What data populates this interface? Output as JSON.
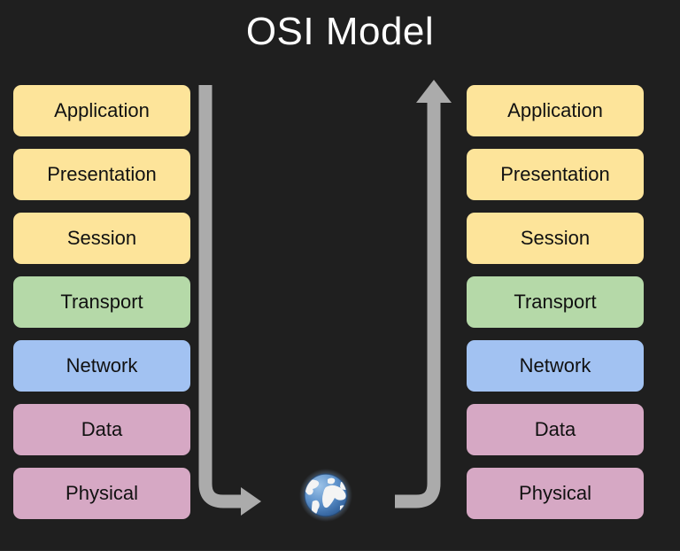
{
  "diagram": {
    "title": "OSI Model",
    "background_color": "#1f1f1f",
    "title_color": "#ffffff"
  },
  "layer_colors": {
    "application": "#fde49a",
    "presentation": "#fde49a",
    "session": "#fde49a",
    "transport": "#b5d9a8",
    "network": "#a2c2f2",
    "data": "#d6a8c4",
    "physical": "#d6a8c4",
    "text": "#111111"
  },
  "left_stack": {
    "name": "left-host-layers",
    "layers": [
      {
        "label": "Application",
        "color": "#fde49a"
      },
      {
        "label": "Presentation",
        "color": "#fde49a"
      },
      {
        "label": "Session",
        "color": "#fde49a"
      },
      {
        "label": "Transport",
        "color": "#b5d9a8"
      },
      {
        "label": "Network",
        "color": "#a2c2f2"
      },
      {
        "label": "Data",
        "color": "#d6a8c4"
      },
      {
        "label": "Physical",
        "color": "#d6a8c4"
      }
    ]
  },
  "right_stack": {
    "name": "right-host-layers",
    "layers": [
      {
        "label": "Application",
        "color": "#fde49a"
      },
      {
        "label": "Presentation",
        "color": "#fde49a"
      },
      {
        "label": "Session",
        "color": "#fde49a"
      },
      {
        "label": "Transport",
        "color": "#b5d9a8"
      },
      {
        "label": "Network",
        "color": "#a2c2f2"
      },
      {
        "label": "Data",
        "color": "#d6a8c4"
      },
      {
        "label": "Physical",
        "color": "#d6a8c4"
      }
    ]
  },
  "arrows": {
    "color": "#ababab",
    "descending": {
      "name": "encapsulation-arrow-down",
      "direction": "down-then-right"
    },
    "ascending": {
      "name": "decapsulation-arrow-up",
      "direction": "right-then-up"
    }
  },
  "center_icon": {
    "name": "globe-icon",
    "ocean_color": "#5b8fc9",
    "land_color": "#f2f2f2"
  }
}
